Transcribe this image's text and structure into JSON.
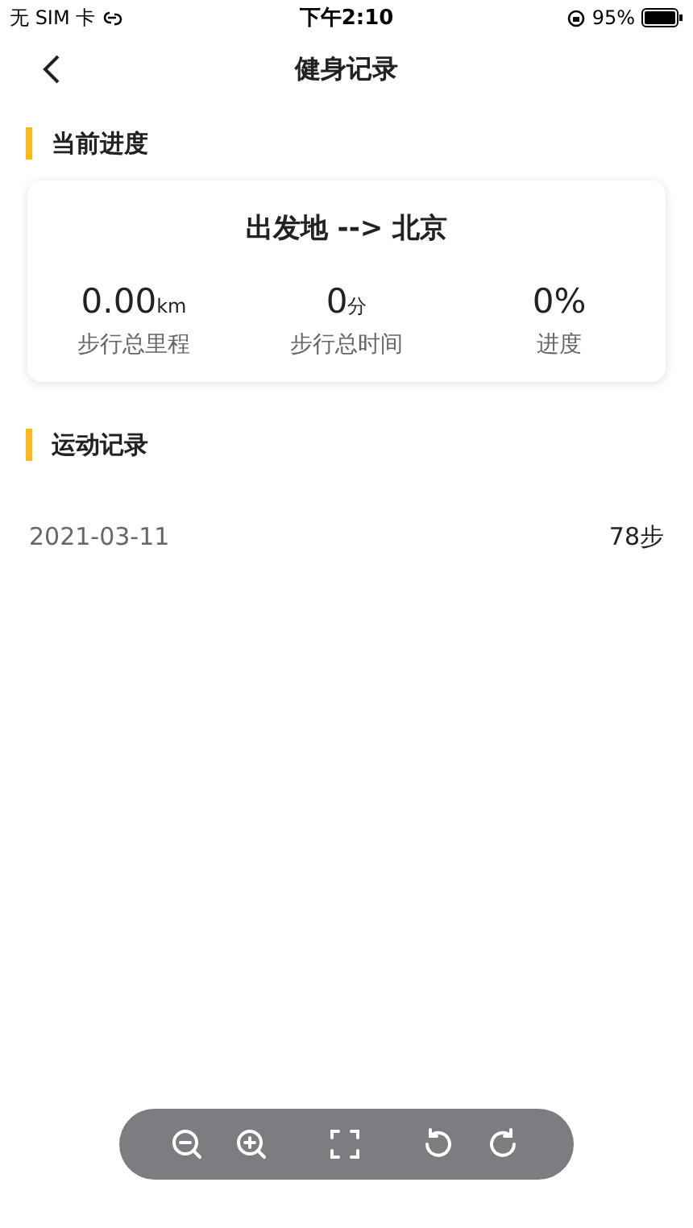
{
  "status_bar": {
    "carrier": "无 SIM 卡",
    "time": "下午2:10",
    "battery": "95%"
  },
  "nav": {
    "title": "健身记录"
  },
  "progress_section": {
    "title": "当前进度"
  },
  "progress_card": {
    "route": "出发地 --> 北京",
    "stats": [
      {
        "value": "0.00",
        "unit": "km",
        "label": "步行总里程"
      },
      {
        "value": "0",
        "unit": "分",
        "label": "步行总时间"
      },
      {
        "value": "0%",
        "label": "进度"
      }
    ]
  },
  "records_section": {
    "title": "运动记录"
  },
  "records": [
    {
      "date": "2021-03-11",
      "steps": "78步"
    }
  ]
}
